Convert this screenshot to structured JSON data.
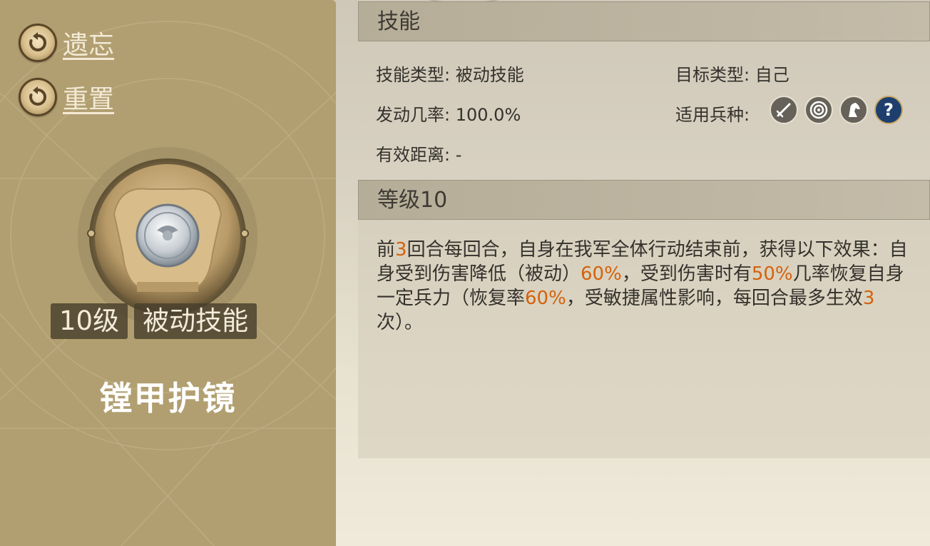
{
  "actions": [
    {
      "label": "遗忘",
      "icon": "reset-icon"
    },
    {
      "label": "重置",
      "icon": "reset-icon"
    }
  ],
  "skill": {
    "level_badge": "10级",
    "type_badge": "被动技能",
    "name": "镗甲护镜",
    "emblem_icon": "armor-shield-icon"
  },
  "sections": {
    "skill_header": "技能",
    "level_header": "等级10"
  },
  "info": {
    "skill_type": {
      "label": "技能类型:",
      "value": "被动技能"
    },
    "target_type": {
      "label": "目标类型:",
      "value": "自己"
    },
    "trigger_rate": {
      "label": "发动几率:",
      "value": "100.0%"
    },
    "unit_types": {
      "label": "适用兵种:",
      "icons": [
        "sword-icon",
        "target-icon",
        "horse-icon",
        "help-icon"
      ]
    },
    "range": {
      "label": "有效距离:",
      "value": "-"
    }
  },
  "description": {
    "segments": [
      {
        "text": "前",
        "hl": false
      },
      {
        "text": "3",
        "hl": true
      },
      {
        "text": "回合每回合，自身在我军全体行动结束前，获得以下效果：自身受到伤害降低（被动）",
        "hl": false
      },
      {
        "text": "60%",
        "hl": true
      },
      {
        "text": "，受到伤害时有",
        "hl": false
      },
      {
        "text": "50%",
        "hl": true
      },
      {
        "text": "几率恢复自身一定兵力（恢复率",
        "hl": false
      },
      {
        "text": "60%",
        "hl": true
      },
      {
        "text": "，受敏捷属性影响，每回合最多生效",
        "hl": false
      },
      {
        "text": "3",
        "hl": true
      },
      {
        "text": "次）。",
        "hl": false
      }
    ]
  },
  "colors": {
    "highlight": "#d4620c",
    "left_panel": "#b19f71",
    "text": "#34312c"
  }
}
